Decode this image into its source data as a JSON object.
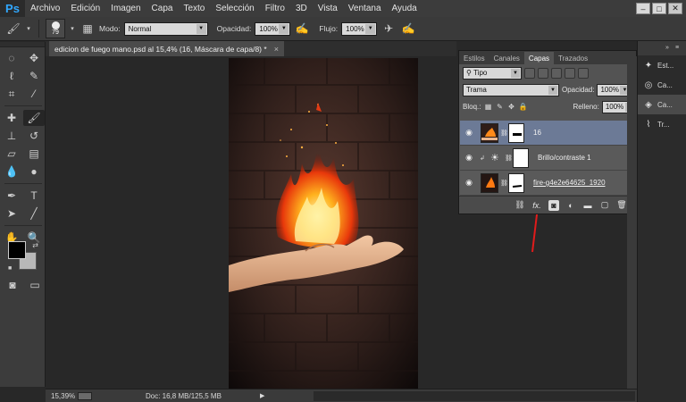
{
  "app": {
    "logo": "Ps"
  },
  "menu": [
    "Archivo",
    "Edición",
    "Imagen",
    "Capa",
    "Texto",
    "Selección",
    "Filtro",
    "3D",
    "Vista",
    "Ventana",
    "Ayuda"
  ],
  "options_bar": {
    "brush_size": "79",
    "mode_label": "Modo:",
    "mode_value": "Normal",
    "opacity_label": "Opacidad:",
    "opacity_value": "100%",
    "flow_label": "Flujo:",
    "flow_value": "100%"
  },
  "document": {
    "tab_title": "edicion de fuego mano.psd al 15,4% (16, Máscara de capa/8) *",
    "close_glyph": "×"
  },
  "status": {
    "zoom": "15,39%",
    "doc_info": "Doc: 16,8 MB/125,5 MB",
    "arrow": "▶"
  },
  "layers_panel": {
    "tabs": [
      "Estilos",
      "Canales",
      "Capas",
      "Trazados"
    ],
    "active_tab": "Capas",
    "filter_value": "Tipo",
    "blend_mode": "Trama",
    "opacity_label": "Opacidad:",
    "opacity_value": "100%",
    "lock_label": "Bloq.:",
    "fill_label": "Relleno:",
    "fill_value": "100%",
    "layers": [
      {
        "name": "16",
        "selected": true,
        "type": "image-mask"
      },
      {
        "name": "Brillo/contraste 1",
        "selected": false,
        "type": "adjustment"
      },
      {
        "name": "fire-g4e2e64625_1920",
        "selected": false,
        "type": "image-mask"
      }
    ],
    "footer_fx": "fx."
  },
  "dock": {
    "items": [
      {
        "label": "Est...",
        "icon": "styles-icon"
      },
      {
        "label": "Ca...",
        "icon": "channels-icon"
      },
      {
        "label": "Ca...",
        "icon": "layers-icon"
      },
      {
        "label": "Tr...",
        "icon": "paths-icon"
      }
    ]
  },
  "colors": {
    "foreground": "#000000",
    "background": "#b8b8b8",
    "selected_layer": "#6c7a96",
    "annotation_arrow": "#e01b1b"
  }
}
